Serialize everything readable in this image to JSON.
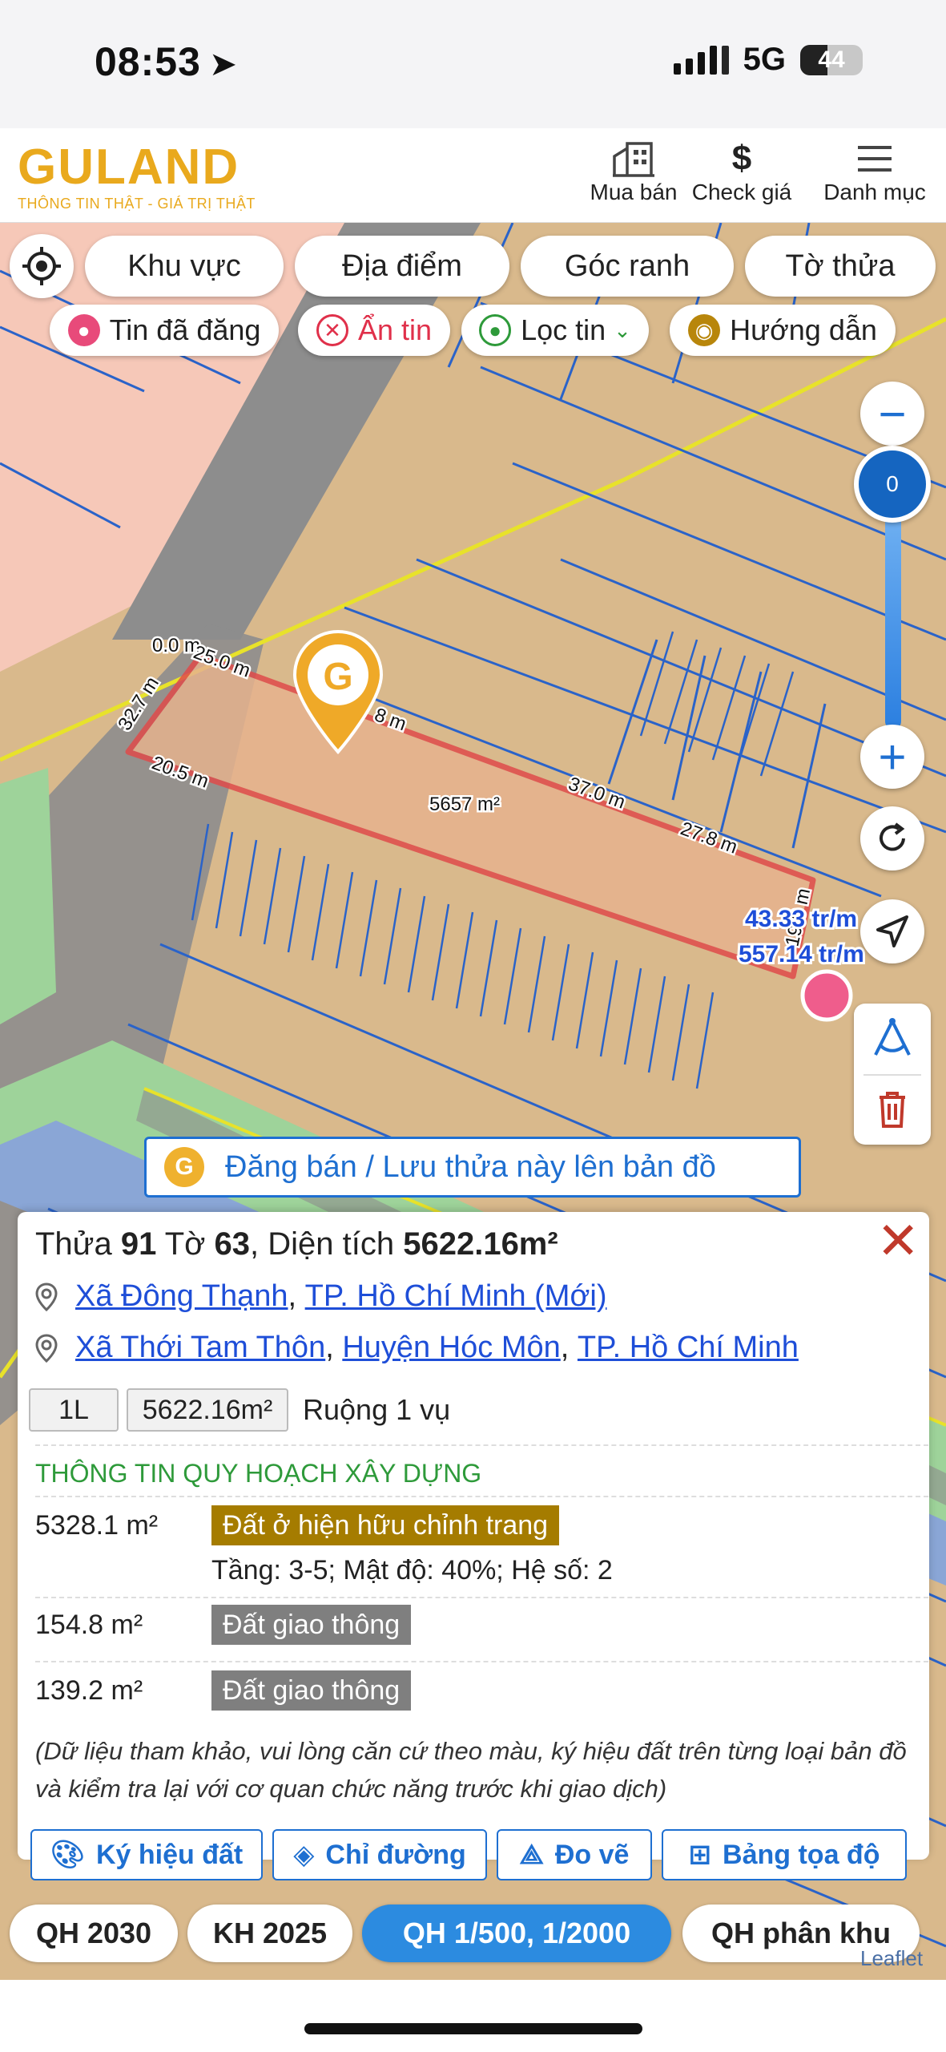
{
  "status": {
    "time": "08:53",
    "network": "5G",
    "battery": "44",
    "battery_level": 0.44
  },
  "header": {
    "logo": "GULAND",
    "tagline": "THÔNG TIN THẬT - GIÁ TRỊ THẬT",
    "buttons": [
      {
        "label": "Mua bán",
        "icon": "building-icon"
      },
      {
        "label": "Check giá",
        "icon": "dollar-icon"
      },
      {
        "label": "Danh mục",
        "icon": "menu-icon"
      }
    ]
  },
  "map_filters": [
    "Khu vực",
    "Địa điểm",
    "Góc ranh",
    "Tờ thửa"
  ],
  "map_toggles": [
    {
      "label": "Tin đã đăng",
      "color": "#e84a7a"
    },
    {
      "label": "Ẩn tin",
      "color": "#e0304a"
    },
    {
      "label": "Lọc tin",
      "color": "#2e9a3a"
    },
    {
      "label": "Hướng dẫn",
      "color": "#b8860b"
    }
  ],
  "map": {
    "zoom_value": "0",
    "area_label": "5657 m²",
    "edge_labels": [
      "0.0 m",
      "25.0 m",
      "32.7 m",
      "20.5 m",
      "37.0 m",
      "27.8 m",
      "19.3 m",
      "8 m"
    ],
    "price_labels": [
      "43.33 tr/m",
      "557.14 tr/m"
    ]
  },
  "save_banner": "Đăng bán / Lưu thửa này lên bản đồ",
  "parcel": {
    "title_prefix": "Thửa",
    "plot_no": "91",
    "sheet_prefix": "Tờ",
    "sheet_no": "63",
    "area_prefix": ", Diện tích",
    "area": "5622.16m²",
    "address_new": [
      {
        "text": "Xã Đông Thạnh",
        "sep": ", "
      },
      {
        "text": "TP. Hồ Chí Minh (Mới)",
        "sep": ""
      }
    ],
    "address_old": [
      {
        "text": "Xã Thới Tam Thôn",
        "sep": ", "
      },
      {
        "text": "Huyện Hóc Môn",
        "sep": ", "
      },
      {
        "text": "TP. Hồ Chí Minh",
        "sep": ""
      }
    ],
    "tag_code": "1L",
    "tag_area": "5622.16m²",
    "land_type": "Ruộng 1 vụ",
    "plan_heading": "THÔNG TIN QUY HOẠCH XÂY DỰNG",
    "plan_rows": [
      {
        "area": "5328.1 m²",
        "type": "Đất ở hiện hữu chỉnh trang",
        "color": "#a57c00",
        "detail": "Tầng: 3-5; Mật độ: 40%; Hệ số: 2"
      },
      {
        "area": "154.8 m²",
        "type": "Đất giao thông",
        "color": "#7f7f7f",
        "detail": ""
      },
      {
        "area": "139.2 m²",
        "type": "Đất giao thông",
        "color": "#7f7f7f",
        "detail": ""
      }
    ],
    "note": "(Dữ liệu tham khảo, vui lòng căn cứ theo màu, ký hiệu đất trên từng loại bản đồ và kiểm tra lại với cơ quan chức năng trước khi giao dịch)",
    "actions": [
      {
        "label": "Ký hiệu đất",
        "icon": "palette-icon"
      },
      {
        "label": "Chỉ đường",
        "icon": "directions-icon"
      },
      {
        "label": "Đo vẽ",
        "icon": "measure-icon"
      },
      {
        "label": "Bảng tọa độ",
        "icon": "table-icon"
      }
    ]
  },
  "layers": [
    {
      "label": "QH 2030",
      "active": false
    },
    {
      "label": "KH 2025",
      "active": false
    },
    {
      "label": "QH 1/500, 1/2000",
      "active": true
    },
    {
      "label": "QH phân khu",
      "active": false
    }
  ],
  "attribution": "Leaflet"
}
